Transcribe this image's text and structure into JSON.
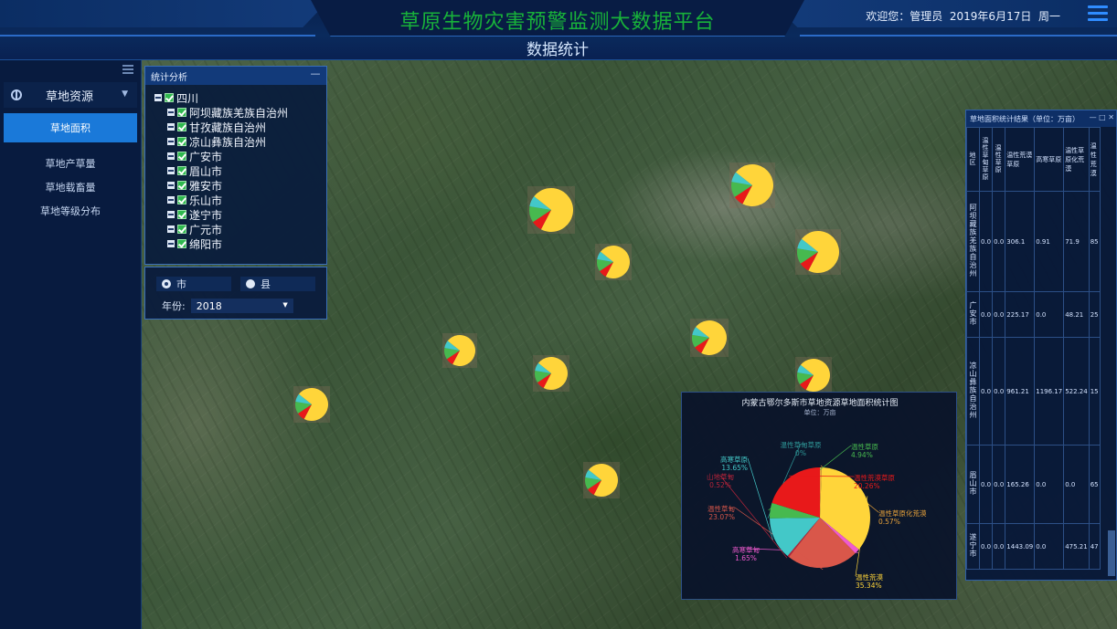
{
  "header": {
    "app_title": "草原生物灾害预警监测大数据平台",
    "sub_title": "数据统计",
    "welcome": "欢迎您：管理员",
    "date": "2019年6月17日",
    "weekday": "周一"
  },
  "leftnav": {
    "group_label": "草地资源",
    "items": [
      {
        "label": "草地面积",
        "active": true
      },
      {
        "label": "草地产草量",
        "active": false
      },
      {
        "label": "草地载畜量",
        "active": false
      },
      {
        "label": "草地等级分布",
        "active": false
      }
    ]
  },
  "stats_panel": {
    "title": "统计分析",
    "tree": {
      "root": "四川",
      "children": [
        "阿坝藏族羌族自治州",
        "甘孜藏族自治州",
        "凉山彝族自治州",
        "广安市",
        "眉山市",
        "雅安市",
        "乐山市",
        "遂宁市",
        "广元市",
        "绵阳市"
      ]
    }
  },
  "filter": {
    "radio_city": "市",
    "radio_county": "县",
    "year_label": "年份:",
    "year_value": "2018"
  },
  "table_panel": {
    "title": "草地面积统计结果（单位：万亩）",
    "columns": [
      "地区",
      "温性草甸草原",
      "温性草原",
      "温性荒漠草原",
      "高寒草原",
      "温性草原化荒漠",
      "温性荒漠"
    ],
    "rows": [
      {
        "region": "阿坝藏族羌族自治州",
        "cells": [
          "0.0",
          "0.0",
          "306.1",
          "0.91",
          "71.9",
          "85"
        ]
      },
      {
        "region": "广安市",
        "cells": [
          "0.0",
          "0.0",
          "225.17",
          "0.0",
          "48.21",
          "25"
        ]
      },
      {
        "region": "凉山彝族自治州",
        "cells": [
          "0.0",
          "0.0",
          "961.21",
          "1196.17",
          "522.24",
          "15"
        ]
      },
      {
        "region": "眉山市",
        "cells": [
          "0.0",
          "0.0",
          "165.26",
          "0.0",
          "0.0",
          "65"
        ]
      },
      {
        "region": "遂宁市",
        "cells": [
          "0.0",
          "0.0",
          "1443.09",
          "0.0",
          "475.21",
          "47"
        ]
      }
    ]
  },
  "chart": {
    "title": "内蒙古鄂尔多斯市草地资源草地面积统计图",
    "unit": "单位：万亩",
    "colors": {
      "yellow": "#ffd53a",
      "red": "#e8191a",
      "green": "#47b94f",
      "cyan": "#43c8c8",
      "coral": "#d9574a",
      "pink": "#f05ad0",
      "orange": "#e8a23a",
      "dark": "#b8243a"
    }
  },
  "chart_data": {
    "type": "pie",
    "title": "内蒙古鄂尔多斯市草地资源草地面积统计图",
    "unit": "单位：万亩",
    "slices": [
      {
        "name": "温性草原化荒漠",
        "pct": 0.57,
        "label": "温性草原化荒漠\n0.57%",
        "color": "#e8a23a"
      },
      {
        "name": "温性荒漠",
        "pct": 35.34,
        "label": "温性荒漠\n35.34%",
        "color": "#ffd53a"
      },
      {
        "name": "高寒草甸",
        "pct": 1.65,
        "label": "高寒草甸\n1.65%",
        "color": "#f05ad0"
      },
      {
        "name": "温性草甸",
        "pct": 23.07,
        "label": "温性草甸\n23.07%",
        "color": "#d9574a"
      },
      {
        "name": "山地草甸",
        "pct": 0.52,
        "label": "山地草甸\n0.52%",
        "color": "#b8243a"
      },
      {
        "name": "高寒草原",
        "pct": 13.65,
        "label": "高寒草原\n13.65%",
        "color": "#43c8c8"
      },
      {
        "name": "温性草甸草原",
        "pct": 0.0,
        "label": "温性草甸草原\n0%",
        "color": "#2f9a9a"
      },
      {
        "name": "温性草原",
        "pct": 4.94,
        "label": "温性草原\n4.94%",
        "color": "#47b94f"
      },
      {
        "name": "温性荒漠草原",
        "pct": 20.26,
        "label": "温性荒漠草原\n20.26%",
        "color": "#e8191a"
      }
    ]
  },
  "map_markers": [
    {
      "name": "marker-1"
    },
    {
      "name": "marker-2"
    },
    {
      "name": "marker-3"
    },
    {
      "name": "marker-4"
    },
    {
      "name": "marker-5"
    },
    {
      "name": "marker-6"
    },
    {
      "name": "marker-7"
    },
    {
      "name": "marker-8"
    },
    {
      "name": "marker-9"
    },
    {
      "name": "marker-10"
    },
    {
      "name": "marker-11"
    }
  ]
}
